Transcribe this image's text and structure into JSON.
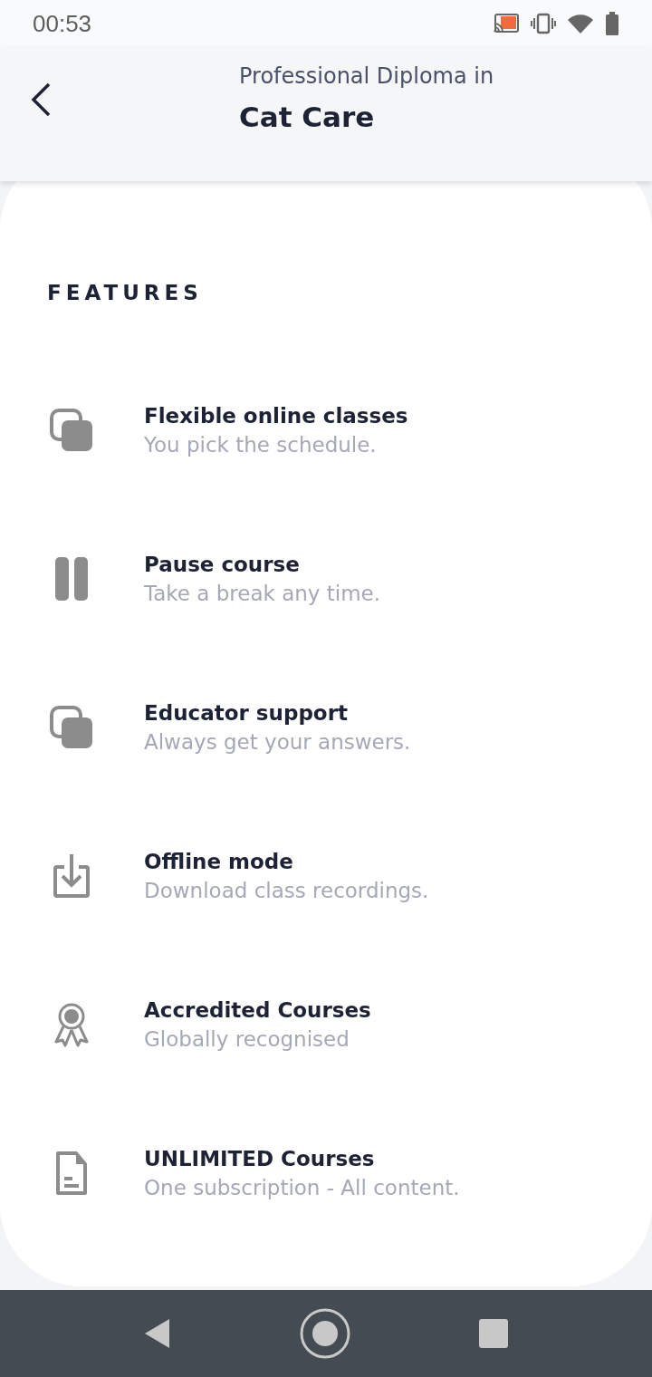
{
  "status_bar": {
    "time": "00:53"
  },
  "header": {
    "subtitle": "Professional Diploma in",
    "title": "Cat Care"
  },
  "features_heading": "FEATURES",
  "features": [
    {
      "kind": "layers",
      "title": "Flexible online classes",
      "subtitle": "You pick the schedule."
    },
    {
      "kind": "pause",
      "title": "Pause course",
      "subtitle": "Take a break any time."
    },
    {
      "kind": "layers",
      "title": "Educator support",
      "subtitle": "Always get your answers."
    },
    {
      "kind": "download",
      "title": "Offline mode",
      "subtitle": "Download class recordings."
    },
    {
      "kind": "award",
      "title": "Accredited Courses",
      "subtitle": "Globally recognised"
    },
    {
      "kind": "document",
      "title": "UNLIMITED Courses",
      "subtitle": "One subscription - All content."
    }
  ]
}
